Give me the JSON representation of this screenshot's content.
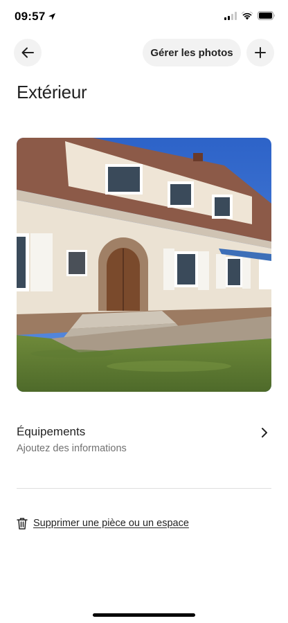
{
  "status_bar": {
    "time": "09:57",
    "icons": [
      "location-arrow-icon",
      "cellular-signal-icon",
      "wifi-icon",
      "battery-icon"
    ]
  },
  "header": {
    "back_icon": "arrow-left-icon",
    "manage_photos_label": "Gérer les photos",
    "add_icon": "plus-icon"
  },
  "page": {
    "title": "Extérieur"
  },
  "photo": {
    "subject": "house-exterior-photo"
  },
  "amenities": {
    "title": "Équipements",
    "subtitle": "Ajoutez des informations",
    "chevron_icon": "chevron-right-icon"
  },
  "delete": {
    "icon": "trash-icon",
    "label": "Supprimer une pièce ou un espace"
  },
  "colors": {
    "text": "#222222",
    "secondary_text": "#717171",
    "button_bg": "#f2f2f2",
    "divider": "#dddddd"
  }
}
